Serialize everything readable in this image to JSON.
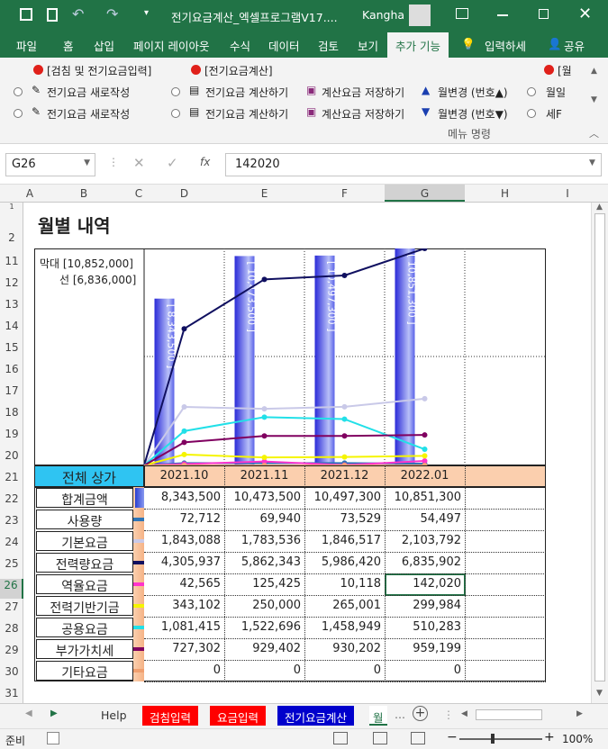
{
  "titlebar": {
    "title": "전기요금계산_엑셀프로그램V17....",
    "user": "Kangha"
  },
  "tabs": [
    "파일",
    "홈",
    "삽입",
    "페이지 레이아웃",
    "수식",
    "데이터",
    "검토",
    "보기",
    "추가 기능",
    "입력하세",
    "공유"
  ],
  "ribbon": {
    "group1_title": "[검침 및 전기요금입력]",
    "group2_title": "[전기요금계산]",
    "group3_title": "[월",
    "item_new1": "전기요금 새로작성",
    "item_new2": "전기요금 새로작성",
    "item_calc1": "전기요금 계산하기",
    "item_calc2": "전기요금 계산하기",
    "item_save1": "계산요금 저장하기",
    "item_save2": "계산요금 저장하기",
    "item_month_up": "월변경 (번호▲)",
    "item_month_down": "월변경 (번호▼)",
    "item_cut1": "월일",
    "item_cut2": "세F",
    "group_label": "메뉴 명령"
  },
  "formula_bar": {
    "cell_ref": "G26",
    "value": "142020",
    "fx": "fx"
  },
  "columns": [
    "A",
    "B",
    "C",
    "D",
    "E",
    "F",
    "G",
    "H",
    "I"
  ],
  "rows": [
    "1",
    "2",
    "11",
    "12",
    "13",
    "14",
    "15",
    "16",
    "17",
    "18",
    "19",
    "20",
    "21",
    "22",
    "23",
    "24",
    "25",
    "26",
    "27",
    "28",
    "29",
    "30",
    "31"
  ],
  "sheet": {
    "title": "월별 내역",
    "legend_bar": "막대 [10,852,000]",
    "legend_line": "선 [6,836,000]",
    "header_label": "전체 상가",
    "months": [
      "2021.10",
      "2021.11",
      "2021.12",
      "2022.01"
    ]
  },
  "chart_data": {
    "type": "bar",
    "categories": [
      "2021.10",
      "2021.11",
      "2021.12",
      "2022.01"
    ],
    "bar_values": [
      8343500,
      10473500,
      10497300,
      10851300
    ],
    "bar_labels": [
      "[ 8,343,500 ]",
      "[ 10,473,500 ]",
      "[ 10,497,300 ]",
      "[ 10,851,300 ]"
    ],
    "bar_max": 10852000,
    "line_max": 6836000,
    "series": [
      {
        "name": "사용량",
        "values": [
          72712,
          69940,
          73529,
          54497
        ],
        "color": "#2e75b6"
      },
      {
        "name": "기본요금",
        "values": [
          1843088,
          1783536,
          1846517,
          2103792
        ],
        "color": "#c9c9e8"
      },
      {
        "name": "전력량요금",
        "values": [
          4305937,
          5862343,
          5986420,
          6835902
        ],
        "color": "#101060"
      },
      {
        "name": "역율요금",
        "values": [
          42565,
          125425,
          10118,
          142020
        ],
        "color": "#ff33cc"
      },
      {
        "name": "전력기반기금",
        "values": [
          343102,
          250000,
          265001,
          299984
        ],
        "color": "#f5f500"
      },
      {
        "name": "공용요금",
        "values": [
          1081415,
          1522696,
          1458949,
          510283
        ],
        "color": "#22e0e8"
      },
      {
        "name": "부가가치세",
        "values": [
          727302,
          929402,
          930202,
          959199
        ],
        "color": "#800060"
      },
      {
        "name": "기타요금",
        "values": [
          0,
          0,
          0,
          0
        ],
        "color": "#f0a070"
      }
    ]
  },
  "table": {
    "total_label": "합계금액",
    "total_values": [
      "8,343,500",
      "10,473,500",
      "10,497,300",
      "10,851,300"
    ],
    "rows": [
      {
        "label": "사용량",
        "values": [
          "72,712",
          "69,940",
          "73,529",
          "54,497"
        ]
      },
      {
        "label": "기본요금",
        "values": [
          "1,843,088",
          "1,783,536",
          "1,846,517",
          "2,103,792"
        ]
      },
      {
        "label": "전력량요금",
        "values": [
          "4,305,937",
          "5,862,343",
          "5,986,420",
          "6,835,902"
        ]
      },
      {
        "label": "역율요금",
        "values": [
          "42,565",
          "125,425",
          "10,118",
          "142,020"
        ]
      },
      {
        "label": "전력기반기금",
        "values": [
          "343,102",
          "250,000",
          "265,001",
          "299,984"
        ]
      },
      {
        "label": "공용요금",
        "values": [
          "1,081,415",
          "1,522,696",
          "1,458,949",
          "510,283"
        ]
      },
      {
        "label": "부가가치세",
        "values": [
          "727,302",
          "929,402",
          "930,202",
          "959,199"
        ]
      },
      {
        "label": "기타요금",
        "values": [
          "0",
          "0",
          "0",
          "0"
        ]
      }
    ]
  },
  "sheet_tabs": {
    "help": "Help",
    "t1": "검침입력",
    "t2": "요금입력",
    "t3": "전기요금계산",
    "t4": "월"
  },
  "status": {
    "ready": "준비",
    "zoom": "100%"
  }
}
